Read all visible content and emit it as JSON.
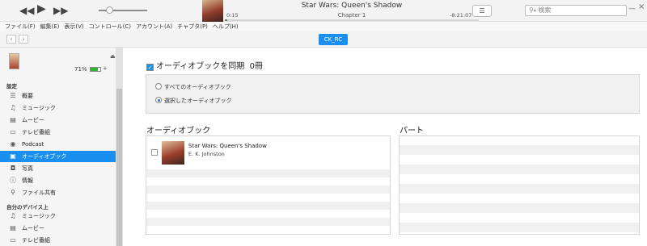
{
  "now_playing": {
    "title": "Star Wars: Queen's Shadow",
    "chapter": "Chapter 1",
    "elapsed": "0:15",
    "remaining": "-8:21:07",
    "progress": 0.01
  },
  "search": {
    "placeholder": "検索"
  },
  "menu": [
    "ファイル(F)",
    "編集(E)",
    "表示(V)",
    "コントロール(C)",
    "アカウント(A)",
    "チャプタ(P)",
    "ヘルプ(H)"
  ],
  "device": {
    "name": "CK_RC",
    "battery_text": "71%",
    "battery_level": 0.71
  },
  "sidebar": {
    "section_settings": "設定",
    "settings_items": [
      {
        "label": "概要",
        "icon": "summary-icon"
      },
      {
        "label": "ミュージック",
        "icon": "music-icon"
      },
      {
        "label": "ムービー",
        "icon": "movie-icon"
      },
      {
        "label": "テレビ番組",
        "icon": "tv-icon"
      },
      {
        "label": "Podcast",
        "icon": "podcast-icon"
      },
      {
        "label": "オーディオブック",
        "icon": "audiobook-icon",
        "selected": true
      },
      {
        "label": "写真",
        "icon": "photo-icon"
      },
      {
        "label": "情報",
        "icon": "info-icon"
      },
      {
        "label": "ファイル共有",
        "icon": "file-share-icon"
      }
    ],
    "section_on_device": "自分のデバイス上",
    "device_items": [
      {
        "label": "ミュージック",
        "icon": "music-icon"
      },
      {
        "label": "ムービー",
        "icon": "movie-icon"
      },
      {
        "label": "テレビ番組",
        "icon": "tv-icon"
      }
    ]
  },
  "main": {
    "sync_label": "オーディオブックを同期",
    "sync_count": "0冊",
    "sync_checked": true,
    "option_all": "すべてのオーディオブック",
    "option_selected": "選択したオーディオブック",
    "selected_option": "selected",
    "audiobooks_heading": "オーディオブック",
    "parts_heading": "パート",
    "books": [
      {
        "title": "Star Wars: Queen's Shadow",
        "author": "E. K. Johnston",
        "checked": false
      }
    ]
  },
  "colors": {
    "accent": "#1a8ff0",
    "sidebar_bg": "#f5f5f5",
    "stripe": "#f0f0f0"
  }
}
